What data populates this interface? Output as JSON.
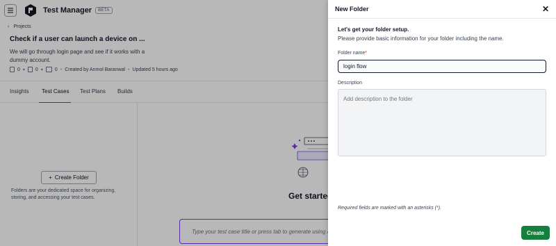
{
  "app": {
    "title": "Test Manager",
    "badge": "BETA"
  },
  "breadcrumb": {
    "label": "Projects"
  },
  "test_case": {
    "title": "Check if a user can launch a device on ...",
    "description": "We will go through login page and see if it works with a dummy account.",
    "meta": {
      "count_a": "0",
      "count_b": "0",
      "count_c": "0",
      "created_by": "Created by Anmol Baranwal",
      "updated": "Updated 5 hours ago"
    }
  },
  "tabs": [
    {
      "label": "Insights"
    },
    {
      "label": "Test Cases",
      "active": true
    },
    {
      "label": "Test Plans"
    },
    {
      "label": "Builds"
    }
  ],
  "left_pane": {
    "create_folder_label": "Create Folder",
    "hint": "Folders are your dedicated space for organizing, storing, and accessing your test cases."
  },
  "main": {
    "empty_title": "Get started",
    "input_placeholder": "Type your test case title or press tab to generate using A"
  },
  "drawer": {
    "title": "New Folder",
    "heading": "Let's get your folder setup.",
    "subheading": "Please provide basic information for your folder including the name.",
    "name_label": "Folder name",
    "name_required_mark": "*",
    "name_value": "login flow",
    "description_label": "Description",
    "description_placeholder": "Add description to the folder",
    "required_note": "Required fields are marked with an asterisks (*).",
    "create_label": "Create"
  },
  "colors": {
    "accent_tab": "#dc2626",
    "create_button": "#15803d",
    "input_focus": "#7c3aed"
  },
  "icons": [
    "hamburger-menu-icon",
    "logo-icon",
    "chevron-left-icon",
    "close-icon",
    "plus-icon",
    "document-icon",
    "clipboard-icon",
    "run-icon",
    "folder-illustration"
  ]
}
